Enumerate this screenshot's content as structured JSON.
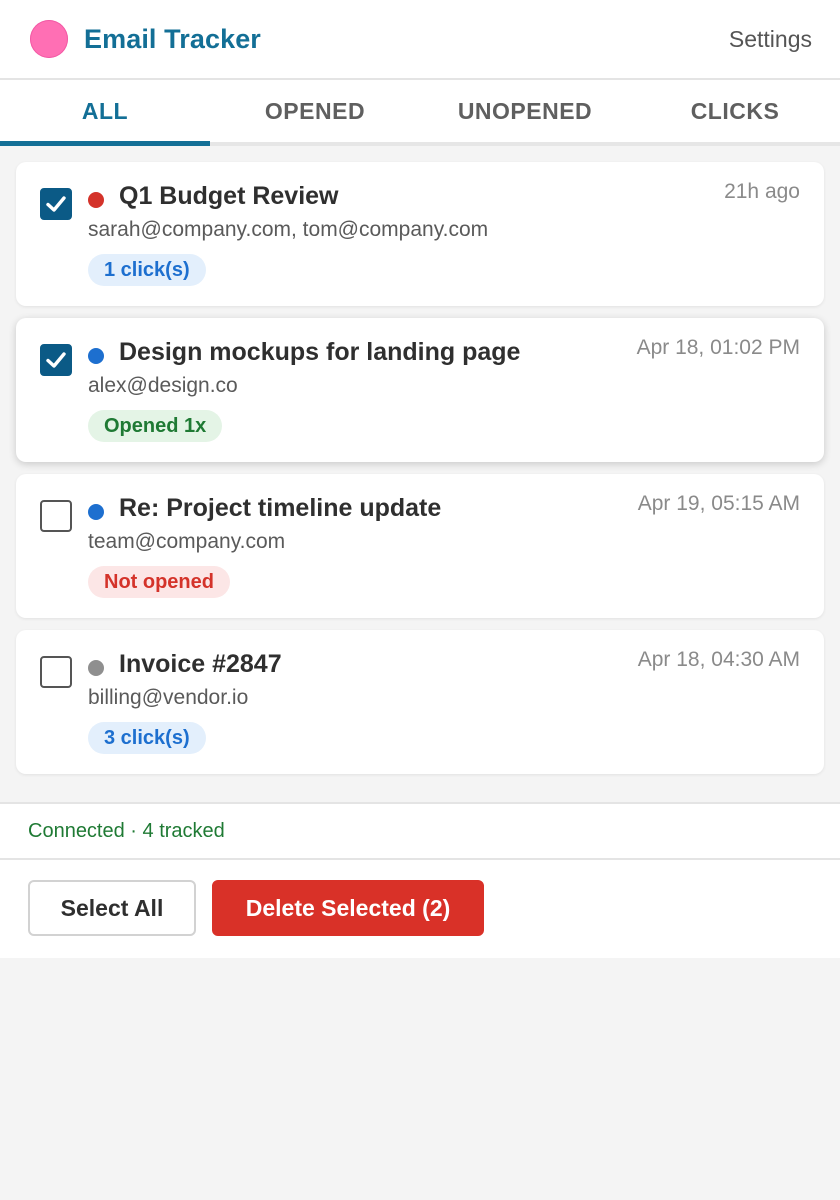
{
  "header": {
    "title": "Email Tracker",
    "settings_label": "Settings",
    "logo_color": "#ff6fb4"
  },
  "tabs": [
    {
      "label": "ALL",
      "active": true
    },
    {
      "label": "OPENED",
      "active": false
    },
    {
      "label": "UNOPENED",
      "active": false
    },
    {
      "label": "CLICKS",
      "active": false
    }
  ],
  "emails": [
    {
      "subject": "Q1 Budget Review",
      "recipients": "sarah@company.com, tom@company.com",
      "time": "21h ago",
      "badge": "1 click(s)",
      "badge_type": "clicks",
      "dot_color": "#d4332a",
      "checked": true
    },
    {
      "subject": "Design mockups for landing page",
      "recipients": "alex@design.co",
      "time": "Apr 18, 01:02 PM",
      "badge": "Opened 1x",
      "badge_type": "opened",
      "dot_color": "#1d6fcf",
      "checked": true
    },
    {
      "subject": "Re: Project timeline update",
      "recipients": "team@company.com",
      "time": "Apr 19, 05:15 AM",
      "badge": "Not opened",
      "badge_type": "unopened",
      "dot_color": "#1d6fcf",
      "checked": false
    },
    {
      "subject": "Invoice #2847",
      "recipients": "billing@vendor.io",
      "time": "Apr 18, 04:30 AM",
      "badge": "3 click(s)",
      "badge_type": "clicks",
      "dot_color": "#8f8f8f",
      "checked": false
    }
  ],
  "status": {
    "text": "Connected · 4 tracked",
    "color": "#1f7a34"
  },
  "actions": {
    "select_all_label": "Select All",
    "delete_label": "Delete Selected (2)",
    "danger_color": "#d93128"
  },
  "colors": {
    "accent": "#136f96",
    "checkbox_checked": "#0b5a86"
  }
}
